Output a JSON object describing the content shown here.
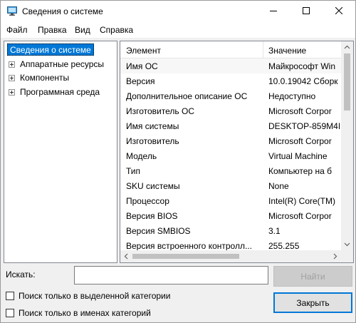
{
  "window": {
    "title": "Сведения о системе"
  },
  "menu": [
    "Файл",
    "Правка",
    "Вид",
    "Справка"
  ],
  "tree": {
    "root": "Сведения о системе",
    "children": [
      "Аппаратные ресурсы",
      "Компоненты",
      "Программная среда"
    ]
  },
  "table": {
    "columns": [
      "Элемент",
      "Значение"
    ],
    "rows": [
      [
        "Имя ОС",
        "Майкрософт Win"
      ],
      [
        "Версия",
        "10.0.19042 Сборк"
      ],
      [
        "Дополнительное описание ОС",
        "Недоступно"
      ],
      [
        "Изготовитель ОС",
        "Microsoft Corpor"
      ],
      [
        "Имя системы",
        "DESKTOP-859M4I"
      ],
      [
        "Изготовитель",
        "Microsoft Corpor"
      ],
      [
        "Модель",
        "Virtual Machine"
      ],
      [
        "Тип",
        "Компьютер на б"
      ],
      [
        "SKU системы",
        "None"
      ],
      [
        "Процессор",
        "Intel(R) Core(TM)"
      ],
      [
        "Версия BIOS",
        "Microsoft Corpor"
      ],
      [
        "Версия SMBIOS",
        "3.1"
      ],
      [
        "Версия встроенного контролл...",
        "255.255"
      ]
    ]
  },
  "search": {
    "label": "Искать:",
    "value": "",
    "find_button": "Найти",
    "close_button": "Закрыть",
    "option_selected_category": "Поиск только в выделенной категории",
    "option_category_names": "Поиск только в именах категорий"
  },
  "colors": {
    "selection": "#0078d7",
    "window_bg": "#f0f0f0"
  },
  "icons": {
    "app": "system-info-icon",
    "minimize": "minimize-icon",
    "maximize": "maximize-icon",
    "close": "close-icon",
    "expander": "plus-expander-icon"
  }
}
